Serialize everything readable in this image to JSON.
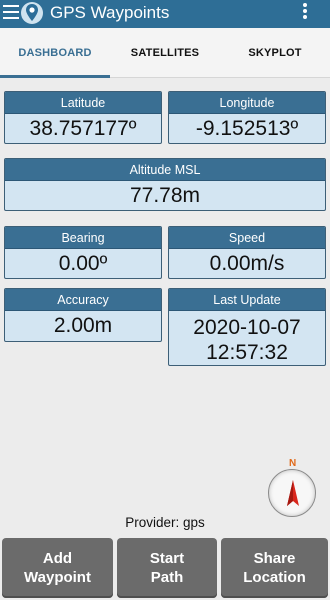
{
  "app": {
    "title": "GPS Waypoints"
  },
  "tabs": [
    {
      "label": "DASHBOARD",
      "active": true
    },
    {
      "label": "SATELLITES",
      "active": false
    },
    {
      "label": "SKYPLOT",
      "active": false
    }
  ],
  "cards": {
    "latitude": {
      "label": "Latitude",
      "value": "38.757177º"
    },
    "longitude": {
      "label": "Longitude",
      "value": "-9.152513º"
    },
    "altitude": {
      "label": "Altitude MSL",
      "value": "77.78m"
    },
    "bearing": {
      "label": "Bearing",
      "value": "0.00º"
    },
    "speed": {
      "label": "Speed",
      "value": "0.00m/s"
    },
    "accuracy": {
      "label": "Accuracy",
      "value": "2.00m"
    },
    "last_update": {
      "label": "Last Update",
      "date": "2020-10-07",
      "time": "12:57:32"
    }
  },
  "compass": {
    "north_label": "N",
    "heading_deg": 0
  },
  "provider": "Provider: gps",
  "buttons": [
    {
      "line1": "Add",
      "line2": "Waypoint"
    },
    {
      "line1": "Start",
      "line2": "Path"
    },
    {
      "line1": "Share",
      "line2": "Location"
    }
  ],
  "colors": {
    "appbar": "#2e6e96",
    "card_header": "#3a6f93",
    "card_body": "#d3e5f2",
    "button": "#6b6b6b",
    "compass_needle": "#d9261c"
  }
}
